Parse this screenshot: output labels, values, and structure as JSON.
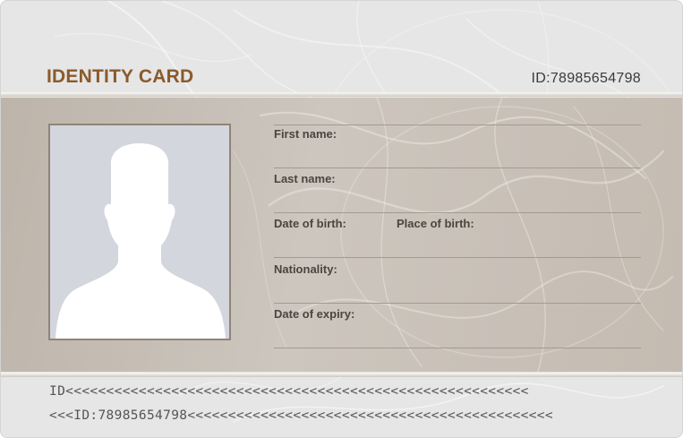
{
  "card": {
    "title": "IDENTITY CARD",
    "id_label": "ID:78985654798"
  },
  "fields": {
    "first_name": "First name:",
    "last_name": "Last name:",
    "date_of_birth": "Date of birth:",
    "place_of_birth": "Place of birth:",
    "nationality": "Nationality:",
    "date_of_expiry": "Date of expiry:"
  },
  "photo": {
    "icon": "person-silhouette-icon"
  },
  "mrz": {
    "line1": "ID<<<<<<<<<<<<<<<<<<<<<<<<<<<<<<<<<<<<<<<<<<<<<<<<<<<<<<<<<",
    "line2": "<<<ID:78985654798<<<<<<<<<<<<<<<<<<<<<<<<<<<<<<<<<<<<<<<<<<<<<"
  },
  "colors": {
    "title": "#8b5a2b",
    "mid_background": "#c8c0b7",
    "header_background": "#e6e6e6",
    "photo_background": "#d4d6de"
  }
}
